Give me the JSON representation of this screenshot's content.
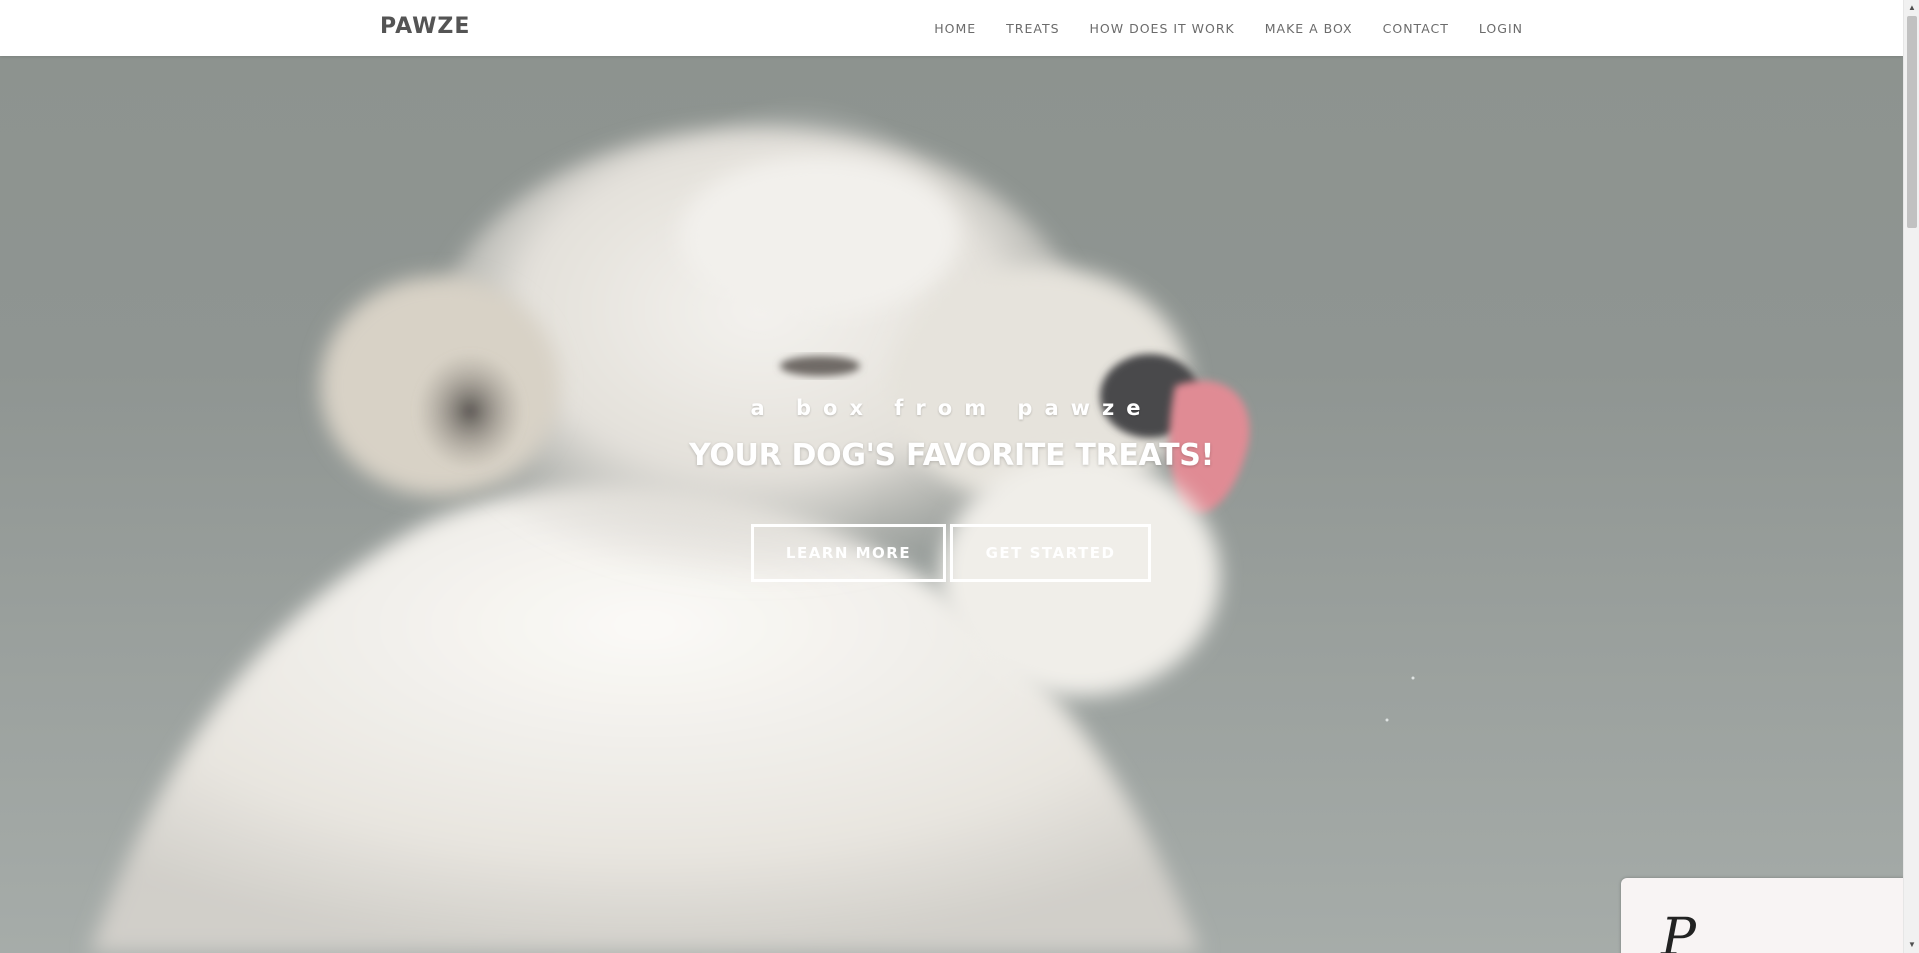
{
  "navbar": {
    "brand": "PAWZE",
    "links": [
      "HOME",
      "TREATS",
      "HOW DOES IT WORK",
      "MAKE A BOX",
      "CONTACT",
      "LOGIN"
    ]
  },
  "hero": {
    "tagline": "a box from pawze",
    "headline": "YOUR DOG'S FAVORITE TREATS!",
    "buttons": {
      "learn_more": "LEARN MORE",
      "get_started": "GET STARTED"
    },
    "image_icon": "dog-photo"
  },
  "corner_card": {
    "letter": "P"
  },
  "scrollbar": {
    "up_icon": "▲",
    "down_icon": "▼"
  },
  "colors": {
    "nav_bg": "#ffffff",
    "nav_text": "#6b6b6b",
    "brand_text": "#545454",
    "hero_text": "#ffffff",
    "hero_bg": "#8f9592"
  }
}
